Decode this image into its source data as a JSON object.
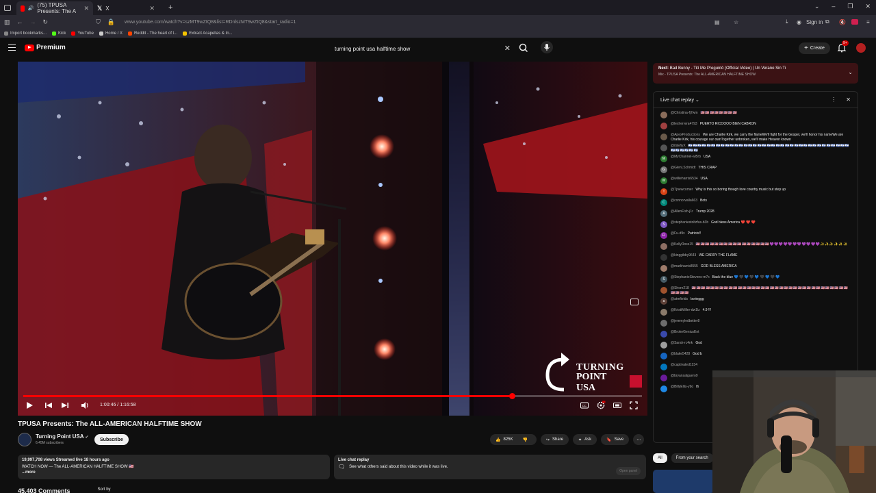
{
  "browser": {
    "active_tab_title": "(75) TPUSA Presents: The A",
    "second_tab_title": "X",
    "url": "www.youtube.com/watch?v=szMT9wZtQ8&list=RDnlszMT9wZtQ8&start_radio=1",
    "sign_in": "Sign in",
    "bookmarks": [
      {
        "label": "Import bookmarks...",
        "color": "#888888"
      },
      {
        "label": "Kick",
        "color": "#53fc18"
      },
      {
        "label": "YouTube",
        "color": "#ff0000"
      },
      {
        "label": "Home / X",
        "color": "#cccccc"
      },
      {
        "label": "Reddit - The heart of t...",
        "color": "#ff4500"
      },
      {
        "label": "Extract Acapellas & In...",
        "color": "#f5c400"
      }
    ]
  },
  "header": {
    "logo_text": "Premium",
    "search_value": "turning point usa halftime show",
    "create_label": "Create",
    "notif_count": "9+"
  },
  "video": {
    "current_time": "1:00:46",
    "duration": "1:16:58",
    "progress": 0.79,
    "brand_line1": "TURNING",
    "brand_line2": "POINT USA"
  },
  "info": {
    "title": "TPUSA Presents: The ALL-AMERICAN HALFTIME SHOW",
    "channel": "Turning Point USA",
    "subscribers": "6.45M subscribers",
    "subscribe_label": "Subscribe",
    "likes": "825K",
    "share_label": "Share",
    "ask_label": "Ask",
    "save_label": "Save",
    "desc_stats": "19,997,708 views  Streamed live 18 hours ago",
    "desc_line": "WATCH NOW — The ALL-AMERICAN HALFTIME SHOW 🇺🇸",
    "desc_more": "...more",
    "chat_card_title": "Live chat replay",
    "chat_card_text": "See what others said about this video while it was live.",
    "chat_card_open": "Open panel",
    "comments_count": "45,403 Comments",
    "sort_by": "Sort by"
  },
  "next": {
    "prefix": "Next:",
    "title": "Bad Bunny - Tití Me Preguntó (Official Video) | Un Verano Sin Ti",
    "sub": "Mix - TPUSA Presents: The ALL-AMERICAN HALFTIME SHOW"
  },
  "chat": {
    "header": "Live chat replay",
    "messages": [
      {
        "author": "@Christina-fj7wm",
        "text": "🇺🇸🇺🇸🇺🇸🇺🇸🇺🇸🇺🇸🇺🇸🇺🇸",
        "emoji": "red",
        "color": "#8a6d5b",
        "initial": ""
      },
      {
        "author": "@lexherrera4793",
        "text": "PUERTO RICOOOO BIEN CABRON",
        "emoji": "",
        "color": "#a04040",
        "initial": ""
      },
      {
        "author": "@ApexProductions",
        "text": "We are Charlie Kirk, we carry the flameWe'll fight for the Gospel, we'll honor his nameWe are Charlie Kirk, his courage our ownTogether unbroken, we'll make Heaven known",
        "emoji": "",
        "color": "#6a5a4a",
        "initial": ""
      },
      {
        "author": "@itsEfiyX",
        "text": "🇮🇱🇮🇱🇮🇱🇮🇱🇮🇱🇮🇱🇮🇱🇮🇱🇮🇱🇮🇱🇮🇱🇮🇱🇮🇱🇮🇱🇮🇱🇮🇱🇮🇱🇮🇱🇮🇱🇮🇱🇮🇱🇮🇱🇮🇱🇮🇱🇮🇱🇮🇱🇮🇱🇮🇱🇮🇱🇮🇱🇮🇱🇮🇱🇮🇱🇮🇱🇮🇱🇮🇱🇮🇱🇮🇱🇮🇱🇮🇱🇮🇱",
        "emoji": "blue",
        "color": "#555555",
        "initial": ""
      },
      {
        "author": "@MyChannel-wl5rb",
        "text": "USA",
        "emoji": "",
        "color": "#2e7d32",
        "initial": "M"
      },
      {
        "author": "@GlenLSchmidt",
        "text": "THIS CRAP",
        "emoji": "",
        "color": "#777777",
        "initial": "G"
      },
      {
        "author": "@willieharris6534",
        "text": "USA",
        "emoji": "",
        "color": "#2e7d32",
        "initial": "W"
      },
      {
        "author": "@Tjnewcomer",
        "text": "Why is this so boring though love country music but step up",
        "emoji": "",
        "color": "#d84315",
        "initial": "T"
      },
      {
        "author": "@connorvalla663",
        "text": "Bots",
        "emoji": "",
        "color": "#00897b",
        "initial": "C"
      },
      {
        "author": "@AllenFish-j1r",
        "text": "Trump 2028",
        "emoji": "",
        "color": "#546e7a",
        "initial": "A"
      },
      {
        "author": "@stephaniestoltzfus-b3b",
        "text": "God bless America ❤️ ❤️ ❤️",
        "emoji": "",
        "color": "#7e57c2",
        "initial": "S"
      },
      {
        "author": "@Fu-d9x",
        "text": "Patriots!!",
        "emoji": "",
        "color": "#8e24aa",
        "initial": "FI"
      },
      {
        "author": "@KellyRoss15",
        "text": "🇺🇸🇺🇸🇺🇸🇺🇸🇺🇸🇺🇸🇺🇸🇺🇸🇺🇸🇺🇸🇺🇸🇺🇸🇺🇸🇺🇸🇺🇸🇺🇸💜💜💜💜💜💜💜💜💜💜💜✨✨✨✨✨✨",
        "emoji": "mixed",
        "color": "#8d6e63",
        "initial": ""
      },
      {
        "author": "@kinggibby9643",
        "text": "WE CARRY THE FLAME",
        "emoji": "",
        "color": "#333333",
        "initial": ""
      },
      {
        "author": "@markharris8555",
        "text": "GOD BLESS AMERICA",
        "emoji": "",
        "color": "#9e7b6a",
        "initial": ""
      },
      {
        "author": "@StephanieStevens-m7x",
        "text": "Back the blue 💙 🖤 💙 🖤 💙 🖤 💙 🖤 💙",
        "emoji": "",
        "color": "#455a64",
        "initial": "S"
      },
      {
        "author": "@Shore218",
        "text": "🇺🇸🇺🇸🇺🇸🇺🇸🇺🇸🇺🇸🇺🇸🇺🇸🇺🇸🇺🇸🇺🇸🇺🇸🇺🇸🇺🇸🇺🇸🇺🇸🇺🇸🇺🇸🇺🇸🇺🇸🇺🇸🇺🇸🇺🇸🇺🇸🇺🇸🇺🇸🇺🇸🇺🇸🇺🇸🇺🇸🇺🇸🇺🇸🇺🇸🇺🇸🇺🇸🇺🇸🇺🇸🇺🇸",
        "emoji": "red",
        "color": "#a0522d",
        "initial": ""
      },
      {
        "author": "@atmfields",
        "text": "boringgg",
        "emoji": "",
        "color": "#5d4037",
        "initial": "a"
      },
      {
        "author": "@KristiMiller-dw1lz",
        "text": "4.9 !!!",
        "emoji": "",
        "color": "#8a7a6a",
        "initial": ""
      },
      {
        "author": "@jeremyledbetter8",
        "text": "",
        "emoji": "",
        "color": "#6d6d6d",
        "initial": ""
      },
      {
        "author": "@BrokeGeniusEnt",
        "text": "",
        "emoji": "",
        "color": "#3949ab",
        "initial": ""
      },
      {
        "author": "@Sarah-rc4nk",
        "text": "God",
        "emoji": "",
        "color": "#9e9e9e",
        "initial": ""
      },
      {
        "author": "@blake5428",
        "text": "God b",
        "emoji": "",
        "color": "#1565c0",
        "initial": ""
      },
      {
        "author": "@captivated1234",
        "text": "",
        "emoji": "",
        "color": "#0277bd",
        "initial": ""
      },
      {
        "author": "@bryansalguero9",
        "text": "",
        "emoji": "",
        "color": "#6a1b9a",
        "initial": ""
      },
      {
        "author": "@BillyEllis-y9o",
        "text": "th",
        "emoji": "",
        "color": "#1e88e5",
        "initial": ""
      }
    ]
  },
  "chips": {
    "all": "All",
    "from_search": "From your search"
  },
  "colors": {
    "accent": "#ff0000",
    "background": "#0f0f0f",
    "next_box": "#3b1214"
  }
}
